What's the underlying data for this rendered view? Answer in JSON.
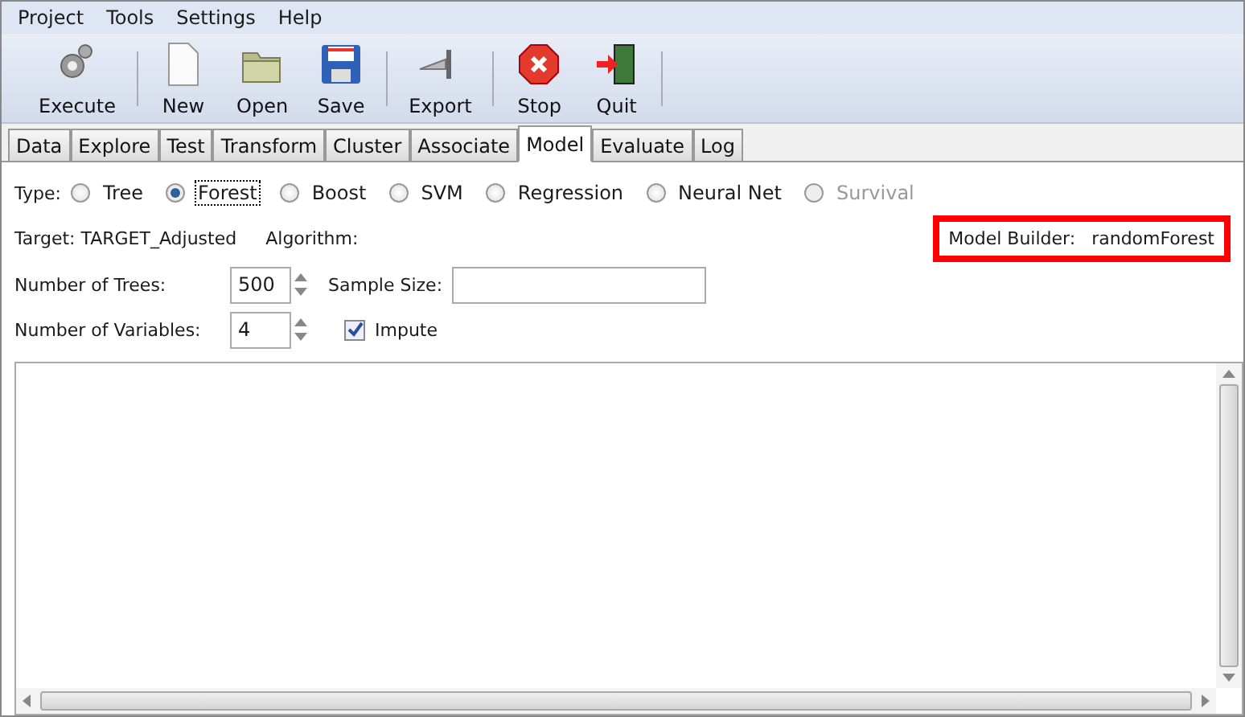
{
  "menu": [
    "Project",
    "Tools",
    "Settings",
    "Help"
  ],
  "toolbar": [
    {
      "label": "Execute",
      "kind": "gears"
    },
    {
      "label": "New",
      "kind": "page"
    },
    {
      "label": "Open",
      "kind": "folder"
    },
    {
      "label": "Save",
      "kind": "disk"
    },
    {
      "label": "Export",
      "kind": "export"
    },
    {
      "label": "Stop",
      "kind": "stop"
    },
    {
      "label": "Quit",
      "kind": "door"
    }
  ],
  "tabs": [
    {
      "label": "Data",
      "selected": false
    },
    {
      "label": "Explore",
      "selected": false
    },
    {
      "label": "Test",
      "selected": false
    },
    {
      "label": "Transform",
      "selected": false
    },
    {
      "label": "Cluster",
      "selected": false
    },
    {
      "label": "Associate",
      "selected": false
    },
    {
      "label": "Model",
      "selected": true
    },
    {
      "label": "Evaluate",
      "selected": false
    },
    {
      "label": "Log",
      "selected": false
    }
  ],
  "type_label": "Type:",
  "types": [
    {
      "label": "Tree",
      "selected": false,
      "disabled": false
    },
    {
      "label": "Forest",
      "selected": true,
      "disabled": false
    },
    {
      "label": "Boost",
      "selected": false,
      "disabled": false
    },
    {
      "label": "SVM",
      "selected": false,
      "disabled": false
    },
    {
      "label": "Regression",
      "selected": false,
      "disabled": false
    },
    {
      "label": "Neural Net",
      "selected": false,
      "disabled": false
    },
    {
      "label": "Survival",
      "selected": false,
      "disabled": true
    }
  ],
  "target": "Target: TARGET_Adjusted",
  "algorithm": "Algorithm:",
  "model_builder": {
    "label": "Model Builder:",
    "value": "randomForest"
  },
  "trees": {
    "label": "Number of Trees:",
    "value": "500"
  },
  "sample_size": {
    "label": "Sample Size:"
  },
  "variables": {
    "label": "Number of Variables:",
    "value": "4"
  },
  "impute": {
    "label": "Impute",
    "checked": true
  }
}
